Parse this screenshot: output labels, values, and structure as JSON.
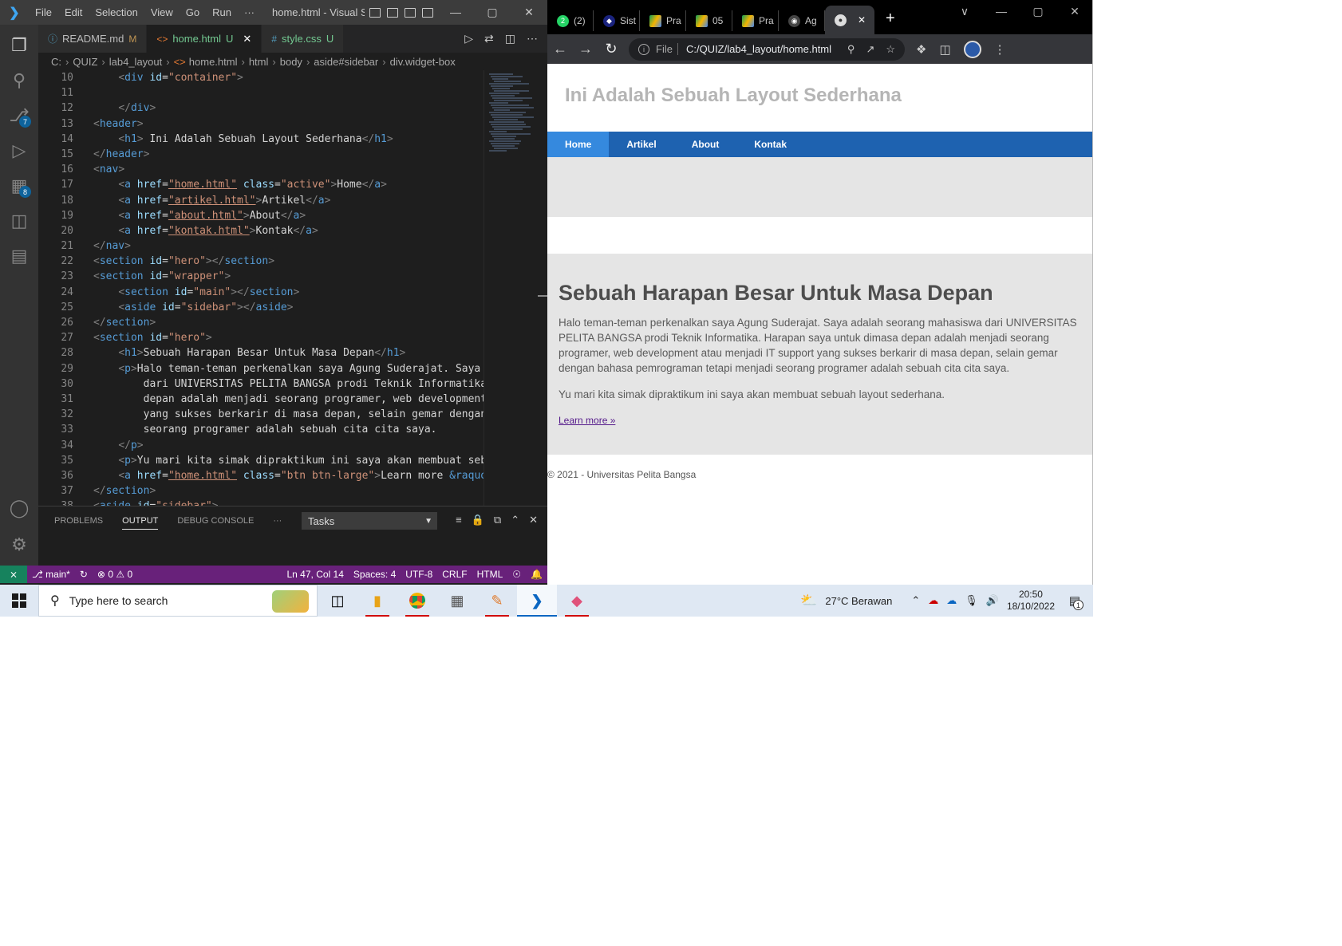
{
  "vscode": {
    "menu": [
      "File",
      "Edit",
      "Selection",
      "View",
      "Go",
      "Run",
      "···"
    ],
    "window_title": "home.html - Visual St...",
    "window_controls": [
      "—",
      "▢",
      "✕"
    ],
    "activity_badges": {
      "source_control": "7",
      "extensions": "8"
    },
    "tabs": [
      {
        "icon": "ⓘ",
        "label": "README.md",
        "status": "M",
        "active": false
      },
      {
        "icon": "<>",
        "label": "home.html",
        "status": "U",
        "close": "✕",
        "active": true
      },
      {
        "icon": "#",
        "label": "style.css",
        "status": "U",
        "active": false
      }
    ],
    "breadcrumb": [
      "C:",
      "QUIZ",
      "lab4_layout",
      "home.html",
      "html",
      "body",
      "aside#sidebar",
      "div.widget-box"
    ],
    "code_lines": [
      {
        "n": "10",
        "parts": [
          [
            "",
            "    "
          ],
          [
            "tg",
            "<"
          ],
          [
            "tn",
            "div"
          ],
          [
            "at",
            " id"
          ],
          [
            "tx",
            "="
          ],
          [
            "av",
            "\"container\""
          ],
          [
            "tg",
            ">"
          ]
        ]
      },
      {
        "n": "11",
        "parts": []
      },
      {
        "n": "12",
        "parts": [
          [
            "",
            "    "
          ],
          [
            "tg",
            "</"
          ],
          [
            "tn",
            "div"
          ],
          [
            "tg",
            ">"
          ]
        ]
      },
      {
        "n": "13",
        "parts": [
          [
            "tg",
            "<"
          ],
          [
            "tn",
            "header"
          ],
          [
            "tg",
            ">"
          ]
        ]
      },
      {
        "n": "14",
        "parts": [
          [
            "",
            "    "
          ],
          [
            "tg",
            "<"
          ],
          [
            "tn",
            "h1"
          ],
          [
            "tg",
            ">"
          ],
          [
            "tx",
            " Ini Adalah Sebuah Layout Sederhana"
          ],
          [
            "tg",
            "</"
          ],
          [
            "tn",
            "h1"
          ],
          [
            "tg",
            ">"
          ]
        ]
      },
      {
        "n": "15",
        "parts": [
          [
            "tg",
            "</"
          ],
          [
            "tn",
            "header"
          ],
          [
            "tg",
            ">"
          ]
        ]
      },
      {
        "n": "16",
        "parts": [
          [
            "tg",
            "<"
          ],
          [
            "tn",
            "nav"
          ],
          [
            "tg",
            ">"
          ]
        ]
      },
      {
        "n": "17",
        "parts": [
          [
            "",
            "    "
          ],
          [
            "tg",
            "<"
          ],
          [
            "tn",
            "a"
          ],
          [
            "at",
            " href"
          ],
          [
            "tx",
            "="
          ],
          [
            "av",
            "\"home.html\""
          ],
          [
            "at",
            " class"
          ],
          [
            "tx",
            "="
          ],
          [
            "av",
            "\"active\""
          ],
          [
            "tg",
            ">"
          ],
          [
            "tx",
            "Home"
          ],
          [
            "tg",
            "</"
          ],
          [
            "tn",
            "a"
          ],
          [
            "tg",
            ">"
          ]
        ]
      },
      {
        "n": "18",
        "parts": [
          [
            "",
            "    "
          ],
          [
            "tg",
            "<"
          ],
          [
            "tn",
            "a"
          ],
          [
            "at",
            " href"
          ],
          [
            "tx",
            "="
          ],
          [
            "av",
            "\"artikel.html\""
          ],
          [
            "tg",
            ">"
          ],
          [
            "tx",
            "Artikel"
          ],
          [
            "tg",
            "</"
          ],
          [
            "tn",
            "a"
          ],
          [
            "tg",
            ">"
          ]
        ]
      },
      {
        "n": "19",
        "parts": [
          [
            "",
            "    "
          ],
          [
            "tg",
            "<"
          ],
          [
            "tn",
            "a"
          ],
          [
            "at",
            " href"
          ],
          [
            "tx",
            "="
          ],
          [
            "av",
            "\"about.html\""
          ],
          [
            "tg",
            ">"
          ],
          [
            "tx",
            "About"
          ],
          [
            "tg",
            "</"
          ],
          [
            "tn",
            "a"
          ],
          [
            "tg",
            ">"
          ]
        ]
      },
      {
        "n": "20",
        "parts": [
          [
            "",
            "    "
          ],
          [
            "tg",
            "<"
          ],
          [
            "tn",
            "a"
          ],
          [
            "at",
            " href"
          ],
          [
            "tx",
            "="
          ],
          [
            "av",
            "\"kontak.html\""
          ],
          [
            "tg",
            ">"
          ],
          [
            "tx",
            "Kontak"
          ],
          [
            "tg",
            "</"
          ],
          [
            "tn",
            "a"
          ],
          [
            "tg",
            ">"
          ]
        ]
      },
      {
        "n": "21",
        "parts": [
          [
            "tg",
            "</"
          ],
          [
            "tn",
            "nav"
          ],
          [
            "tg",
            ">"
          ]
        ]
      },
      {
        "n": "22",
        "parts": [
          [
            "tg",
            "<"
          ],
          [
            "tn",
            "section"
          ],
          [
            "at",
            " id"
          ],
          [
            "tx",
            "="
          ],
          [
            "av",
            "\"hero\""
          ],
          [
            "tg",
            "></"
          ],
          [
            "tn",
            "section"
          ],
          [
            "tg",
            ">"
          ]
        ]
      },
      {
        "n": "23",
        "parts": [
          [
            "tg",
            "<"
          ],
          [
            "tn",
            "section"
          ],
          [
            "at",
            " id"
          ],
          [
            "tx",
            "="
          ],
          [
            "av",
            "\"wrapper\""
          ],
          [
            "tg",
            ">"
          ]
        ]
      },
      {
        "n": "24",
        "parts": [
          [
            "",
            "    "
          ],
          [
            "tg",
            "<"
          ],
          [
            "tn",
            "section"
          ],
          [
            "at",
            " id"
          ],
          [
            "tx",
            "="
          ],
          [
            "av",
            "\"main\""
          ],
          [
            "tg",
            "></"
          ],
          [
            "tn",
            "section"
          ],
          [
            "tg",
            ">"
          ]
        ]
      },
      {
        "n": "25",
        "parts": [
          [
            "",
            "    "
          ],
          [
            "tg",
            "<"
          ],
          [
            "tn",
            "aside"
          ],
          [
            "at",
            " id"
          ],
          [
            "tx",
            "="
          ],
          [
            "av",
            "\"sidebar\""
          ],
          [
            "tg",
            "></"
          ],
          [
            "tn",
            "aside"
          ],
          [
            "tg",
            ">"
          ]
        ]
      },
      {
        "n": "26",
        "parts": [
          [
            "tg",
            "</"
          ],
          [
            "tn",
            "section"
          ],
          [
            "tg",
            ">"
          ]
        ]
      },
      {
        "n": "27",
        "parts": [
          [
            "tg",
            "<"
          ],
          [
            "tn",
            "section"
          ],
          [
            "at",
            " id"
          ],
          [
            "tx",
            "="
          ],
          [
            "av",
            "\"hero\""
          ],
          [
            "tg",
            ">"
          ]
        ]
      },
      {
        "n": "28",
        "parts": [
          [
            "",
            "    "
          ],
          [
            "tg",
            "<"
          ],
          [
            "tn",
            "h1"
          ],
          [
            "tg",
            ">"
          ],
          [
            "tx",
            "Sebuah Harapan Besar Untuk Masa Depan"
          ],
          [
            "tg",
            "</"
          ],
          [
            "tn",
            "h1"
          ],
          [
            "tg",
            ">"
          ]
        ]
      },
      {
        "n": "29",
        "parts": [
          [
            "",
            "    "
          ],
          [
            "tg",
            "<"
          ],
          [
            "tn",
            "p"
          ],
          [
            "tg",
            ">"
          ],
          [
            "tx",
            "Halo teman-teman perkenalkan saya Agung Suderajat. Saya"
          ]
        ]
      },
      {
        "n": "30",
        "parts": [
          [
            "tx",
            "        dari UNIVERSITAS PELITA BANGSA prodi Teknik Informatika"
          ]
        ]
      },
      {
        "n": "31",
        "parts": [
          [
            "tx",
            "        depan adalah menjadi seorang programer, web development"
          ]
        ]
      },
      {
        "n": "32",
        "parts": [
          [
            "tx",
            "        yang sukses berkarir di masa depan, selain gemar dengan"
          ]
        ]
      },
      {
        "n": "33",
        "parts": [
          [
            "tx",
            "        seorang programer adalah sebuah cita cita saya."
          ]
        ]
      },
      {
        "n": "34",
        "parts": [
          [
            "",
            "    "
          ],
          [
            "tg",
            "</"
          ],
          [
            "tn",
            "p"
          ],
          [
            "tg",
            ">"
          ]
        ]
      },
      {
        "n": "35",
        "parts": [
          [
            "",
            "    "
          ],
          [
            "tg",
            "<"
          ],
          [
            "tn",
            "p"
          ],
          [
            "tg",
            ">"
          ],
          [
            "tx",
            "Yu mari kita simak dipraktikum ini saya akan membuat seb"
          ]
        ]
      },
      {
        "n": "36",
        "parts": [
          [
            "",
            "    "
          ],
          [
            "tg",
            "<"
          ],
          [
            "tn",
            "a"
          ],
          [
            "at",
            " href"
          ],
          [
            "tx",
            "="
          ],
          [
            "av",
            "\"home.html\""
          ],
          [
            "at",
            " class"
          ],
          [
            "tx",
            "="
          ],
          [
            "av",
            "\"btn btn-large\""
          ],
          [
            "tg",
            ">"
          ],
          [
            "tx",
            "Learn more "
          ],
          [
            "en",
            "&raquo"
          ]
        ]
      },
      {
        "n": "37",
        "parts": [
          [
            "tg",
            "</"
          ],
          [
            "tn",
            "section"
          ],
          [
            "tg",
            ">"
          ]
        ]
      },
      {
        "n": "38",
        "parts": [
          [
            "tg",
            "<"
          ],
          [
            "tn",
            "aside"
          ],
          [
            "at",
            " id"
          ],
          [
            "tx",
            "="
          ],
          [
            "av",
            "\"sidebar\""
          ],
          [
            "tg",
            ">"
          ]
        ]
      }
    ],
    "panel": {
      "tabs": [
        "PROBLEMS",
        "OUTPUT",
        "DEBUG CONSOLE",
        "···"
      ],
      "active_tab": "OUTPUT",
      "output_channel": "Tasks"
    },
    "status": {
      "branch": "main*",
      "errors": "0",
      "warnings": "0",
      "cursor": "Ln 47, Col 14",
      "spaces": "Spaces: 4",
      "encoding": "UTF-8",
      "eol": "CRLF",
      "language": "HTML"
    }
  },
  "chrome": {
    "tabs": [
      {
        "label": "(2)",
        "icon": "whatsapp-icon",
        "badge": "2"
      },
      {
        "label": "Sist",
        "icon": "site-icon"
      },
      {
        "label": "Pra",
        "icon": "drive-icon"
      },
      {
        "label": "05",
        "icon": "drive-icon"
      },
      {
        "label": "Pra",
        "icon": "drive-icon"
      },
      {
        "label": "Ag",
        "icon": "github-icon"
      },
      {
        "label": "",
        "icon": "globe-icon",
        "active": true,
        "close": "✕"
      }
    ],
    "new_tab": "+",
    "window_controls": [
      "∨",
      "—",
      "▢",
      "✕"
    ],
    "omnibox": {
      "scheme": "File",
      "url": "C:/QUIZ/lab4_layout/home.html"
    }
  },
  "site": {
    "header_title": "Ini Adalah Sebuah Layout Sederhana",
    "nav": [
      {
        "label": "Home",
        "active": true
      },
      {
        "label": "Artikel"
      },
      {
        "label": "About"
      },
      {
        "label": "Kontak"
      }
    ],
    "hero_title": "Sebuah Harapan Besar Untuk Masa Depan",
    "paragraph1": "Halo teman-teman perkenalkan saya Agung Suderajat. Saya adalah seorang mahasiswa dari UNIVERSITAS PELITA BANGSA prodi Teknik Informatika. Harapan saya untuk dimasa depan adalah menjadi seorang programer, web development atau menjadi IT support yang sukses berkarir di masa depan, selain gemar dengan bahasa pemrograman tetapi menjadi seorang programer adalah sebuah cita cita saya.",
    "paragraph2": "Yu mari kita simak dipraktikum ini saya akan membuat sebuah layout sederhana.",
    "learn_more": "Learn more »",
    "footer": "© 2021 - Universitas Pelita Bangsa"
  },
  "taskbar": {
    "search_placeholder": "Type here to search",
    "weather": "27°C  Berawan",
    "time": "20:50",
    "date": "18/10/2022",
    "notification_count": "1"
  },
  "colors": {
    "vscode_status": "#68217a",
    "site_nav": "#1e62b0",
    "site_nav_active": "#3589de",
    "hero_bg": "#e5e5e5"
  }
}
